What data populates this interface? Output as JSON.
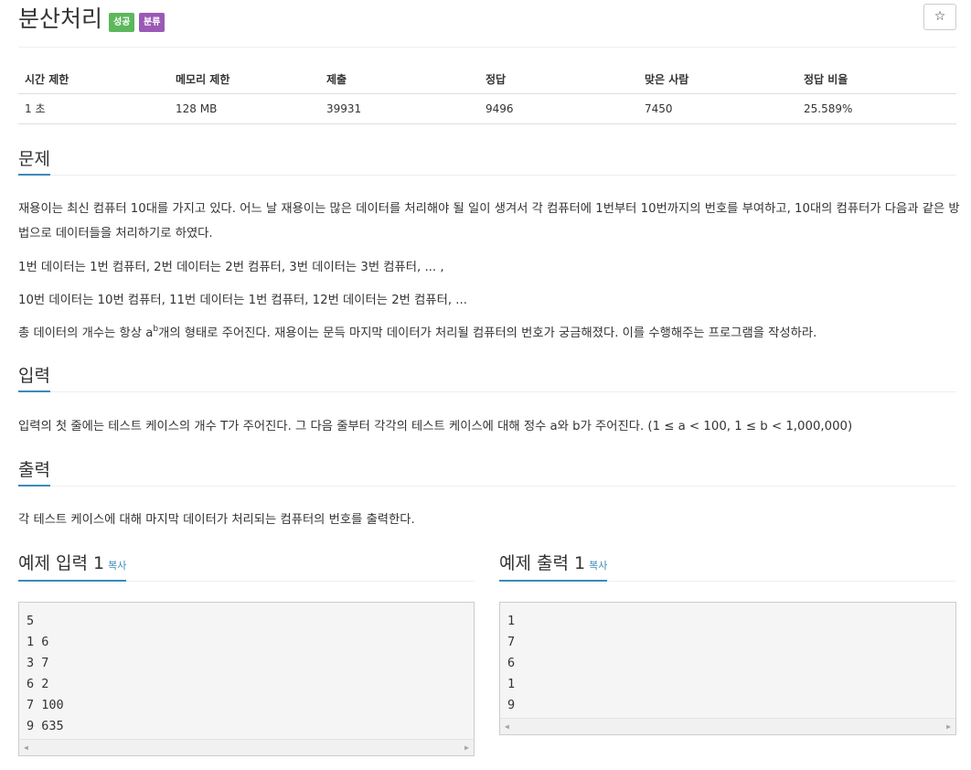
{
  "problem": {
    "title": "분산처리",
    "badge_success": "성공",
    "badge_category": "분류",
    "star_icon": "☆"
  },
  "info": {
    "headers": [
      "시간 제한",
      "메모리 제한",
      "제출",
      "정답",
      "맞은 사람",
      "정답 비율"
    ],
    "values": [
      "1 초",
      "128 MB",
      "39931",
      "9496",
      "7450",
      "25.589%"
    ]
  },
  "sections": {
    "problem_heading": "문제",
    "problem_p1": "재용이는 최신 컴퓨터 10대를 가지고 있다. 어느 날 재용이는 많은 데이터를 처리해야 될 일이 생겨서 각 컴퓨터에 1번부터 10번까지의 번호를 부여하고, 10대의 컴퓨터가 다음과 같은 방법으로 데이터들을 처리하기로 하였다.",
    "problem_p2": "1번 데이터는 1번 컴퓨터, 2번 데이터는 2번 컴퓨터, 3번 데이터는 3번 컴퓨터, ... ,",
    "problem_p3": "10번 데이터는 10번 컴퓨터, 11번 데이터는 1번 컴퓨터, 12번 데이터는 2번 컴퓨터, ...",
    "problem_p4_before": "총 데이터의 개수는 항상 a",
    "problem_p4_sup": "b",
    "problem_p4_after": "개의 형태로 주어진다. 재용이는 문득 마지막 데이터가 처리될 컴퓨터의 번호가 궁금해졌다. 이를 수행해주는 프로그램을 작성하라.",
    "input_heading": "입력",
    "input_text": "입력의 첫 줄에는 테스트 케이스의 개수 T가 주어진다. 그 다음 줄부터 각각의 테스트 케이스에 대해 정수 a와 b가 주어진다. (1 ≤ a < 100, 1 ≤ b < 1,000,000)",
    "output_heading": "출력",
    "output_text": "각 테스트 케이스에 대해 마지막 데이터가 처리되는 컴퓨터의 번호를 출력한다."
  },
  "samples": {
    "input_heading": "예제 입력 1",
    "output_heading": "예제 출력 1",
    "copy_label": "복사",
    "input_lines": [
      "5",
      "1 6",
      "3 7",
      "6 2",
      "7 100",
      "9 635"
    ],
    "output_lines": [
      "1",
      "7",
      "6",
      "1",
      "9"
    ]
  }
}
